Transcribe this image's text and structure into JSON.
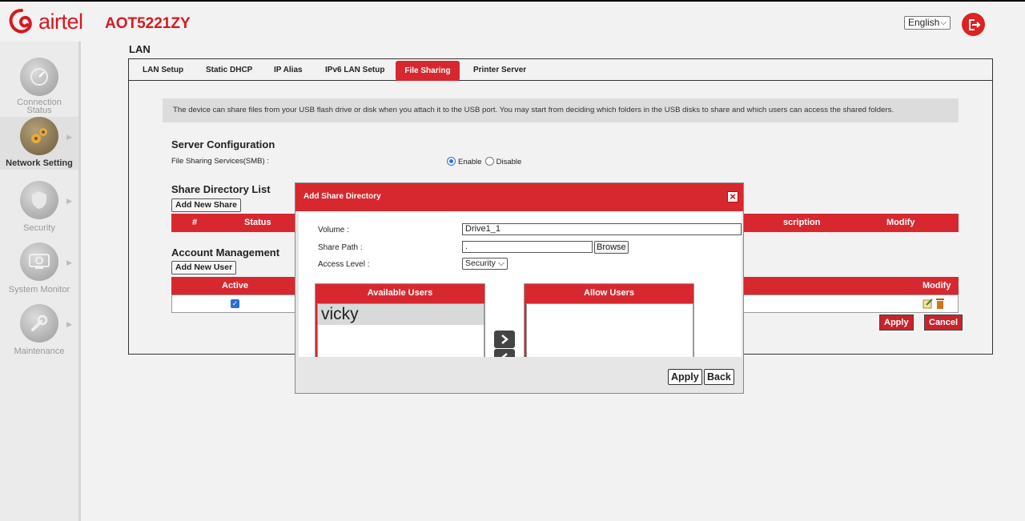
{
  "header": {
    "brand": "airtel",
    "model": "AOT5221ZY",
    "language": "English"
  },
  "sidebar": {
    "items": [
      {
        "label_line1": "Connection",
        "label_line2": "Status"
      },
      {
        "label_line1": "Network Setting"
      },
      {
        "label_line1": "Security"
      },
      {
        "label_line1": "System Monitor"
      },
      {
        "label_line1": "Maintenance"
      }
    ]
  },
  "page": {
    "title": "LAN",
    "tabs": [
      "LAN Setup",
      "Static DHCP",
      "IP Alias",
      "IPv6 LAN Setup",
      "File Sharing",
      "Printer Server"
    ],
    "active_tab": "File Sharing",
    "info_text": "The device can share files from your USB flash drive or disk when you attach it to the USB port. You may start from deciding which folders in the USB disks to share and which users can access the shared folders."
  },
  "server_config": {
    "title": "Server Configuration",
    "smb_label": "File Sharing Services(SMB) :",
    "enable_label": "Enable",
    "disable_label": "Disable",
    "selected": "Enable"
  },
  "share_list": {
    "title": "Share Directory List",
    "add_button": "Add New Share",
    "columns": [
      "#",
      "Status",
      "scription",
      "Modify"
    ]
  },
  "account": {
    "title": "Account Management",
    "add_button": "Add New User",
    "columns": [
      "Active",
      "Modify"
    ],
    "row_active": true
  },
  "actions": {
    "apply": "Apply",
    "cancel": "Cancel"
  },
  "modal": {
    "title": "Add Share Directory",
    "volume_label": "Volume :",
    "volume_value": "Drive1_1",
    "share_path_label": "Share Path :",
    "share_path_value": ".",
    "browse": "Browse",
    "access_label": "Access Level :",
    "access_value": "Security",
    "available_users_title": "Available Users",
    "available_users": [
      "vicky"
    ],
    "allow_users_title": "Allow Users",
    "allow_users": [],
    "apply": "Apply",
    "back": "Back"
  },
  "colors": {
    "brand_red": "#d7282f",
    "logo_red": "#d71920"
  }
}
